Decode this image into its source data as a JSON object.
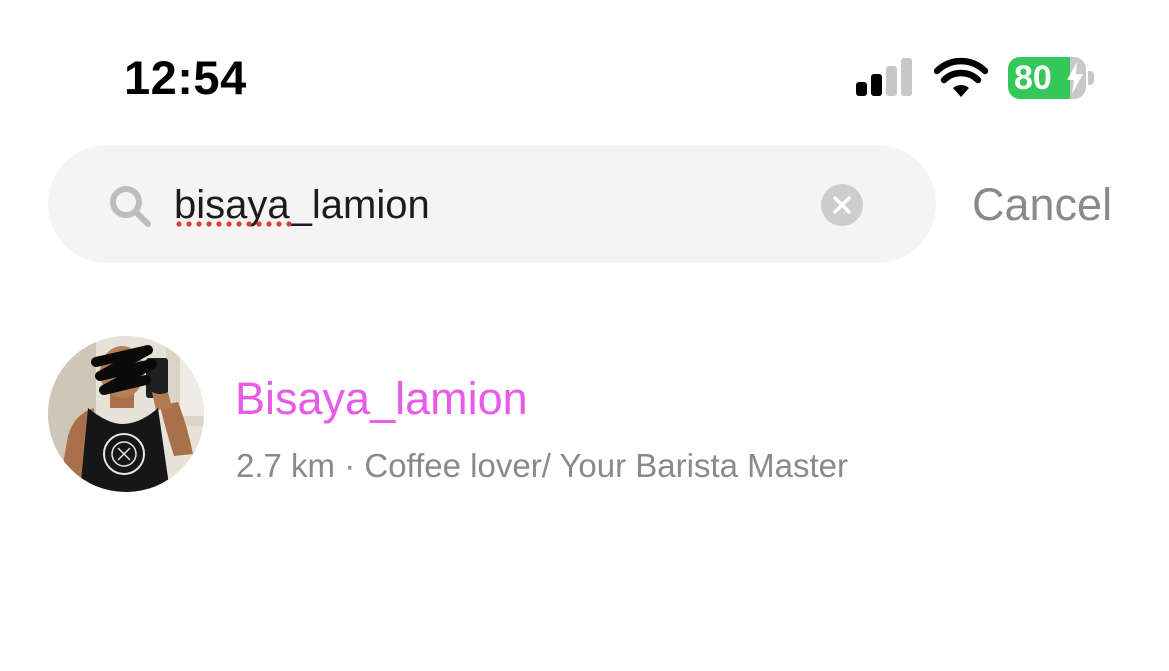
{
  "status_bar": {
    "time": "12:54",
    "battery_percent": "80",
    "battery_level": 0.8,
    "battery_charging": true,
    "signal_bars_active": 2,
    "signal_bars_total": 4,
    "icons": [
      "cellular-signal-icon",
      "wifi-icon",
      "battery-icon",
      "charging-bolt-icon"
    ]
  },
  "search": {
    "query": "bisaya_lamion",
    "icon": "search-icon",
    "clear_icon": "clear-icon",
    "cancel_label": "Cancel"
  },
  "results": [
    {
      "username": "Bisaya_lamion",
      "distance": "2.7 km",
      "separator": " · ",
      "bio": "Coffee lover/ Your Barista Master"
    }
  ],
  "colors": {
    "username_accent": "#e85ae8",
    "battery_green": "#34c759",
    "muted_text": "#8a8a8a",
    "search_background": "#f4f4f4"
  }
}
